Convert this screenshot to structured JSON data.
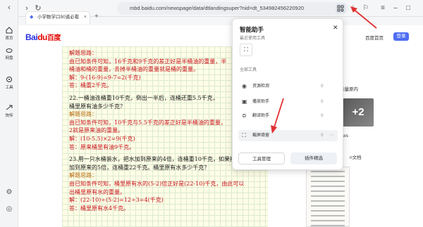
{
  "browser": {
    "url": "mbd.baidu.com/newspage/data/dtlandingsuper?nid=dt_534982456220920",
    "tab_title": "小学数学口50道必看",
    "back_icon": "back-arrow-icon",
    "forward_icon": "forward-arrow-icon",
    "refresh_icon": "refresh-icon"
  },
  "left_rail": {
    "items": [
      {
        "label": "首页",
        "icon": "home-icon"
      },
      {
        "label": "网盘",
        "icon": "cloud-drive-icon"
      },
      {
        "label": "工具",
        "icon": "tools-icon"
      },
      {
        "label": "快传",
        "icon": "transfer-icon"
      }
    ]
  },
  "header": {
    "logo_text": "Bai",
    "logo_paw": "du",
    "logo_cn": "百度",
    "home_link": "百度首页",
    "login": "登录"
  },
  "article": {
    "lines": [
      {
        "text": "解题思路：",
        "color": "red"
      },
      {
        "text": "由已知条件可知，16千克和9千克的差正好是半桶油的重量，半",
        "color": "red"
      },
      {
        "text": "桶油和桶的重量，去掉半桶油的重量就是桶的重量。",
        "color": "red"
      },
      {
        "text": "解：9-(16-9)=9-7=2(千克)",
        "color": "red"
      },
      {
        "text": "答：桶重2千克。",
        "color": "red"
      },
      {
        "text": "",
        "color": "gap"
      },
      {
        "text": "22.一桶油连桶重10千克，倒出一半后，连桶还重5.5千克，",
        "color": "dark"
      },
      {
        "text": "桶里原有油多少千克？",
        "color": "dark"
      },
      {
        "text": "解题思路：",
        "color": "gold"
      },
      {
        "text": "由已知条件可知，10千克与5.5千克的差正好是半桶油的重量，",
        "color": "red"
      },
      {
        "text": "2就是原来油的重量。",
        "color": "red"
      },
      {
        "text": "解：(10-5.5)×2=9(千克)",
        "color": "red"
      },
      {
        "text": "答：原来桶里有油9千克。",
        "color": "red"
      },
      {
        "text": "",
        "color": "gap"
      },
      {
        "text": "23.用一只水桶装水，把水加到原来的4倍，连桶重10千克，如果把水",
        "color": "dark"
      },
      {
        "text": "加到原来的5倍，连桶重22千克。桶里原有水多少千克？",
        "color": "dark"
      },
      {
        "text": "解题思路：",
        "color": "gold"
      },
      {
        "text": "由已知条件可知，桶里原有水的(5-2)倍正好是(22-10)千克，由此可以",
        "color": "red"
      },
      {
        "text": "出桶里原有水的重量。",
        "color": "red"
      },
      {
        "text": "解：(22-10)÷(5-2)=12÷3=4(千克)",
        "color": "red"
      },
      {
        "text": "答：桶里原有水4千克。",
        "color": "red"
      }
    ]
  },
  "right_column": {
    "item1": "重量原内",
    "item2": "ws",
    "item3": "n文档",
    "badge": "+2"
  },
  "toolbar": {
    "assistant_icon": "assistant-grid-icon",
    "download_icon": "download-icon",
    "bookmark_icon": "bookmark-icon",
    "menu_icon": "menu-icon"
  },
  "popup": {
    "title": "智能助手",
    "recent_label": "最近使用工具",
    "all_label": "全部工具",
    "tools": [
      {
        "label": "资源检测",
        "icon": "radar-icon"
      },
      {
        "label": "播放助手",
        "icon": "play-icon"
      },
      {
        "label": "翻译助手",
        "icon": "translate-icon"
      },
      {
        "label": "截屏填留",
        "icon": "screenshot-icon"
      }
    ],
    "manage_button": "工具管理",
    "plugin_button": "插件精选"
  },
  "colors": {
    "accent": "#4e6ef2",
    "article_red": "#c8151d",
    "annotation_arrow": "#e03030"
  }
}
